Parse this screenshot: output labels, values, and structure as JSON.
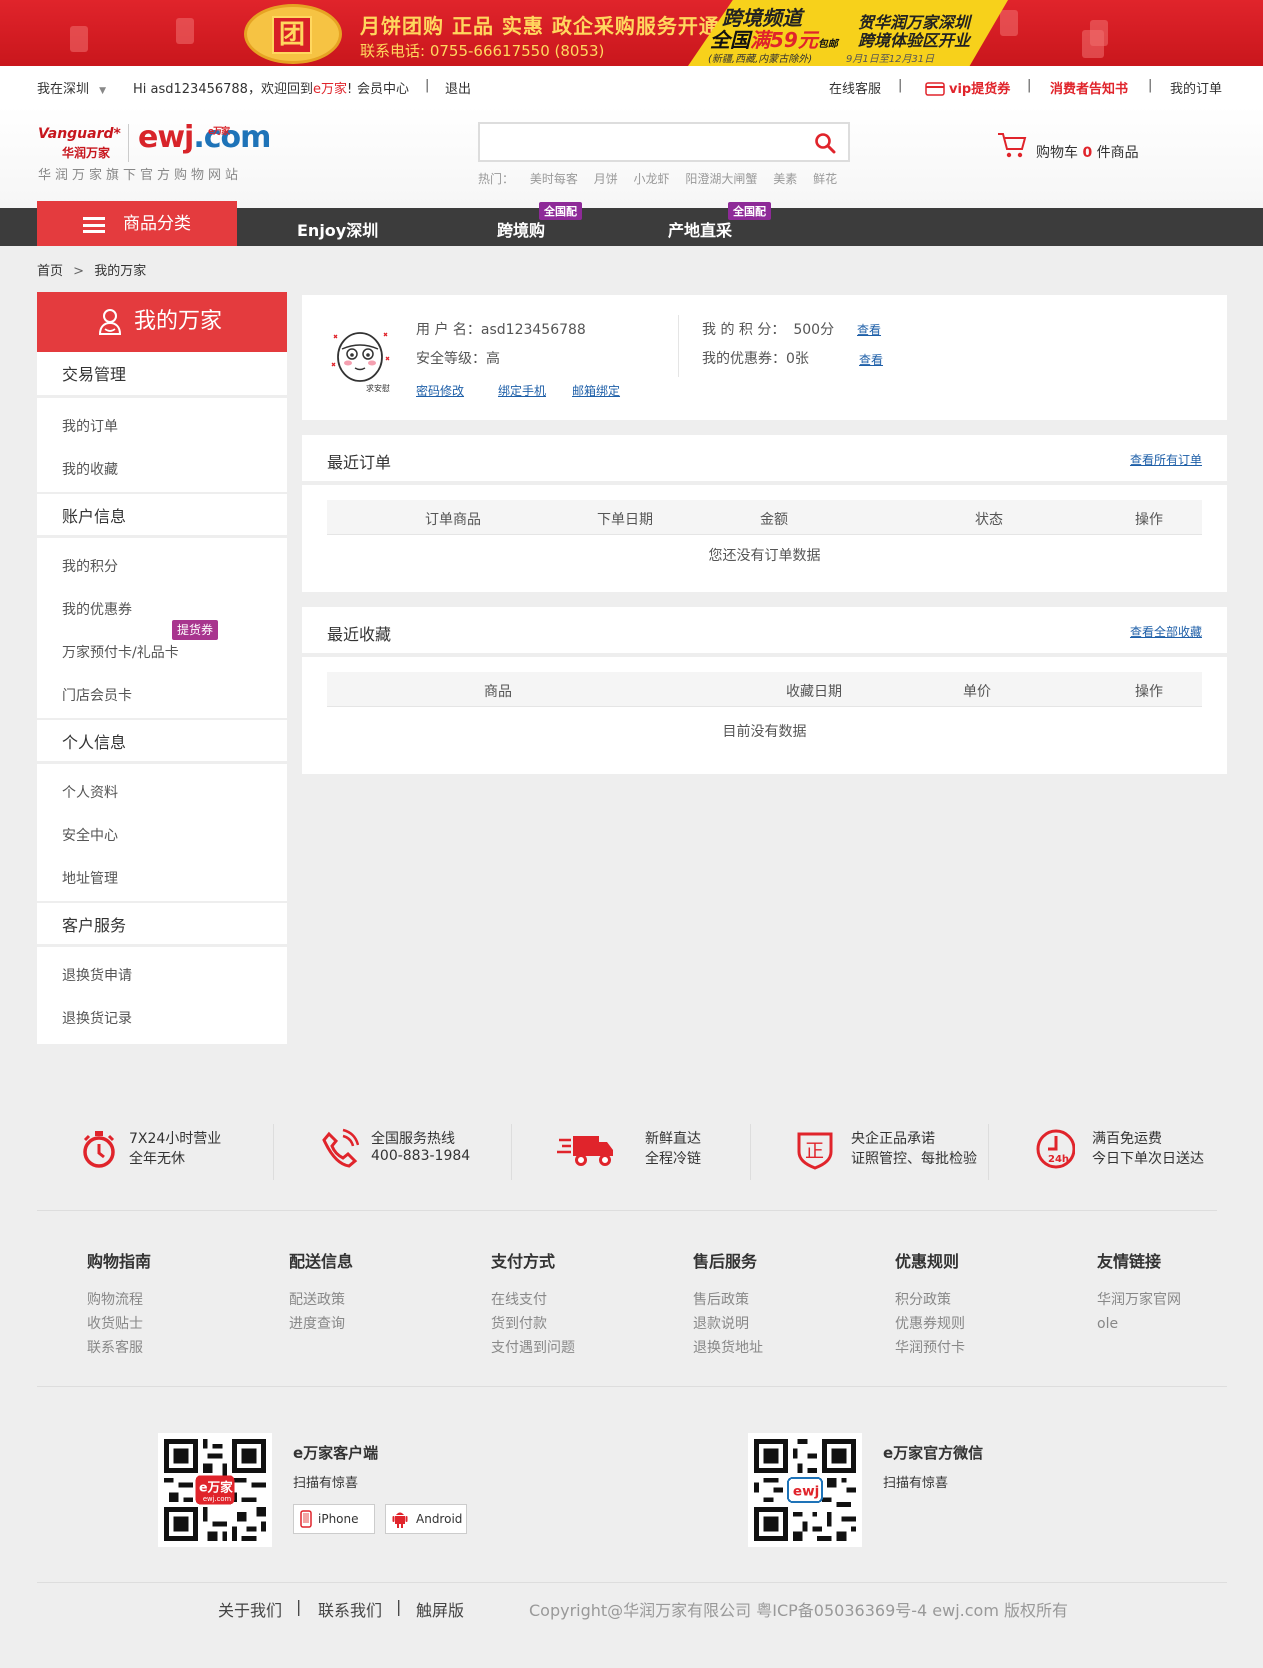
{
  "banner": {
    "group_char": "团",
    "headline": "月饼团购 正品 实惠 政企采购服务开通",
    "phone": "联系电话: 0755-66617550 (8053)",
    "channel": "跨境频道",
    "free_ship_pre": "全国",
    "free_ship_mid": "满59元",
    "free_ship_post": "包邮",
    "free_ship_note": "(新疆,西藏,内蒙古除外)",
    "congrats_line1": "贺华润万家深圳",
    "congrats_line2": "跨境体验区开业",
    "dates": "9月1日至12月31日"
  },
  "topbar": {
    "location": "我在深圳",
    "location_caret": "▼",
    "greeting_pre": "Hi asd123456788，欢迎回到",
    "greeting_site": "e万家",
    "greeting_post": "!",
    "member_center": "会员中心",
    "logout": "退出",
    "online_service": "在线客服",
    "vip": "vip提货券",
    "consumer_notice": "消费者告知书",
    "my_orders": "我的订单",
    "separator": "|"
  },
  "header": {
    "logo_vanguard": "Vanguard",
    "logo_cn": "华润万家",
    "logo_ewj": "ewj",
    "logo_dot": ".com",
    "logo_small": "e万家",
    "slogan": "华润万家旗下官方购物网站",
    "search_placeholder": "",
    "hot_label": "热门：",
    "hot_words": [
      "美时每客",
      "月饼",
      "小龙虾",
      "阳澄湖大闸蟹",
      "美素",
      "鲜花"
    ],
    "cart_pre": "购物车",
    "cart_count": "0",
    "cart_post": "件商品"
  },
  "nav": {
    "category": "商品分类",
    "items": [
      "Enjoy深圳",
      "跨境购",
      "产地直采"
    ],
    "badge1": "全国配",
    "badge2": "全国配"
  },
  "breadcrumb": {
    "home": "首页",
    "sep": ">",
    "current": "我的万家"
  },
  "sidebar": {
    "title": "我的万家",
    "sections": [
      {
        "title": "交易管理",
        "items": [
          "我的订单",
          "我的收藏"
        ]
      },
      {
        "title": "账户信息",
        "items": [
          "我的积分",
          "我的优惠券",
          "万家预付卡/礼品卡",
          "门店会员卡"
        ]
      },
      {
        "title": "个人信息",
        "items": [
          "个人资料",
          "安全中心",
          "地址管理"
        ]
      },
      {
        "title": "客户服务",
        "items": [
          "退换货申请",
          "退换货记录"
        ]
      }
    ],
    "tihuo_badge": "提货券"
  },
  "user": {
    "avatar_label": "求安慰",
    "username_label": "用 户 名：",
    "username": "asd123456788",
    "security_label": "安全等级：",
    "security": "高",
    "pwd_link": "密码修改",
    "phone_link": "绑定手机",
    "email_link": "邮箱绑定",
    "points_label": "我 的 积 分：",
    "points": "500分",
    "coupons_label": "我的优惠券：",
    "coupons": "0张",
    "view1": "查看",
    "view2": "查看"
  },
  "orders": {
    "title": "最近订单",
    "view_all": "查看所有订单",
    "columns": [
      "订单商品",
      "下单日期",
      "金额",
      "状态",
      "操作"
    ],
    "empty": "您还没有订单数据"
  },
  "favorites": {
    "title": "最近收藏",
    "view_all": "查看全部收藏",
    "columns": [
      "商品",
      "收藏日期",
      "单价",
      "操作"
    ],
    "empty": "目前没有数据"
  },
  "services": [
    {
      "l1": "7X24小时营业",
      "l2": "全年无休"
    },
    {
      "l1": "全国服务热线",
      "l2": "400-883-1984"
    },
    {
      "l1": "新鲜直达",
      "l2": "全程冷链"
    },
    {
      "l1": "央企正品承诺",
      "l2": "证照管控、每批检验"
    },
    {
      "l1": "满百免运费",
      "l2": "今日下单次日送达"
    }
  ],
  "service_icon_text": {
    "zheng": "正",
    "h24": "24h"
  },
  "footer_cols": [
    {
      "title": "购物指南",
      "links": [
        "购物流程",
        "收货贴士",
        "联系客服"
      ]
    },
    {
      "title": "配送信息",
      "links": [
        "配送政策",
        "进度查询"
      ]
    },
    {
      "title": "支付方式",
      "links": [
        "在线支付",
        "货到付款",
        "支付遇到问题"
      ]
    },
    {
      "title": "售后服务",
      "links": [
        "售后政策",
        "退款说明",
        "退换货地址"
      ]
    },
    {
      "title": "优惠规则",
      "links": [
        "积分政策",
        "优惠券规则",
        "华润预付卡"
      ]
    },
    {
      "title": "友情链接",
      "links": [
        "华润万家官网",
        "ole"
      ]
    }
  ],
  "qr": {
    "app_title": "e万家客户端",
    "app_sub": "扫描有惊喜",
    "app_logo": "e万家",
    "app_logo_sub": "ewj.com",
    "iphone": "iPhone",
    "android": "Android",
    "wx_title": "e万家官方微信",
    "wx_sub": "扫描有惊喜",
    "wx_logo": "ewj"
  },
  "bottom": {
    "about": "关于我们",
    "contact": "联系我们",
    "touch": "触屏版",
    "sep": "|",
    "copyright": "Copyright@华润万家有限公司  粤ICP备05036369号-4   ewj.com 版权所有"
  },
  "colors": {
    "accent": "#e43b3e",
    "nav": "#3c3c3c",
    "link": "#1e5fa8",
    "badge": "#8e2a98"
  }
}
